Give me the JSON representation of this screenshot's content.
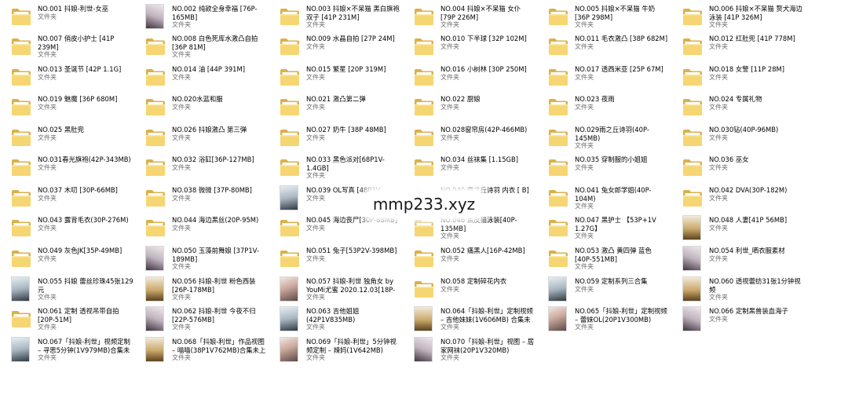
{
  "folder_type": "文件夹",
  "watermark": "mmp233.xyz",
  "items": [
    {
      "name": "NO.001 抖娘-利世-女巫",
      "thumb": "folder"
    },
    {
      "name": "NO.002 纯欲全身幸福 [76P-165MB]",
      "thumb": "img"
    },
    {
      "name": "NO.003 抖娘×不呆猫 黑白旗袍双子 [41P 231M]",
      "thumb": "folder"
    },
    {
      "name": "NO.004 抖娘×不呆猫 女仆 [79P 226M]",
      "thumb": "folder"
    },
    {
      "name": "NO.005 抖娘×不呆猫 牛奶 [36P 298M]",
      "thumb": "folder"
    },
    {
      "name": "NO.006 抖娘×不呆猫 赘犬海边泳装 [41P 326M]",
      "thumb": "folder"
    },
    {
      "name": "NO.007 俏皮小护士 [41P 239M]",
      "thumb": "folder"
    },
    {
      "name": "NO.008 白色死库水激凸自拍 [36P 81M]",
      "thumb": "folder"
    },
    {
      "name": "NO.009 水晶自拍 [27P 24M]",
      "thumb": "folder"
    },
    {
      "name": "NO.010 下半球 [32P 102M]",
      "thumb": "folder"
    },
    {
      "name": "NO.011 毛衣激凸 [38P 682M]",
      "thumb": "folder"
    },
    {
      "name": "NO.012 红肚兜 [41P 778M]",
      "thumb": "folder"
    },
    {
      "name": "NO.013 圣诞节 [42P 1.1G]",
      "thumb": "folder"
    },
    {
      "name": "NO.014 油 [44P 391M]",
      "thumb": "folder"
    },
    {
      "name": "NO.015 繁星 [20P 319M]",
      "thumb": "folder"
    },
    {
      "name": "NO.016 小树林 [30P 250M]",
      "thumb": "folder"
    },
    {
      "name": "NO.017 透西米亚 [25P 67M]",
      "thumb": "folder"
    },
    {
      "name": "NO.018 女警 [11P 28M]",
      "thumb": "folder"
    },
    {
      "name": "NO.019 魅魔 [36P 680M]",
      "thumb": "folder"
    },
    {
      "name": "NO.020水蓝和服",
      "thumb": "folder"
    },
    {
      "name": "NO.021 激凸第二弹",
      "thumb": "folder"
    },
    {
      "name": "NO.022 厨娘",
      "thumb": "folder"
    },
    {
      "name": "NO.023 夜雨",
      "thumb": "folder"
    },
    {
      "name": "NO.024 专属礼物",
      "thumb": "folder"
    },
    {
      "name": "NO.025 黑肚兜",
      "thumb": "folder"
    },
    {
      "name": "NO.026 抖娘激凸 第三弹",
      "thumb": "folder"
    },
    {
      "name": "NO.027 奶牛 [38P 48MB]",
      "thumb": "folder"
    },
    {
      "name": "NO.028窗帘房(42P-466MB)",
      "thumb": "folder"
    },
    {
      "name": "NO.029雨之丘诗羽(40P-145MB)",
      "thumb": "folder"
    },
    {
      "name": "NO.030钻(40P-96MB)",
      "thumb": "folder"
    },
    {
      "name": "NO.031春光旗袍(42P-343MB)",
      "thumb": "folder"
    },
    {
      "name": "NO.032 浴缸[36P-127MB]",
      "thumb": "folder"
    },
    {
      "name": "NO.033 黑色派对[68P1V-1.4GB]",
      "thumb": "folder"
    },
    {
      "name": "NO.034 丝袜集 [1.15GB]",
      "thumb": "folder"
    },
    {
      "name": "NO.035 穿制服的小姐姐",
      "thumb": "folder"
    },
    {
      "name": "NO.036 巫女",
      "thumb": "folder"
    },
    {
      "name": "NO.037 木叨 [30P-66MB]",
      "thumb": "folder"
    },
    {
      "name": "NO.038 微微 [37P-80MB]",
      "thumb": "folder"
    },
    {
      "name": "NO.039 OL写真 [48P1V",
      "thumb": "img"
    },
    {
      "name": "NO.040 霞之丘诗羽 内衣 [ B]",
      "thumb": "folder"
    },
    {
      "name": "NO.041 兔女郎学姐(40P-104M)",
      "thumb": "folder"
    },
    {
      "name": "NO.042 DVA(30P-182M)",
      "thumb": "folder"
    },
    {
      "name": "NO.043 露背毛衣(30P-276M)",
      "thumb": "folder"
    },
    {
      "name": "NO.044 海边黑丝(20P-95M)",
      "thumb": "folder"
    },
    {
      "name": "NO.045 海边丧尸[30P-88MB]",
      "thumb": "folder"
    },
    {
      "name": "NO.046 黑皮猫泳装[40P-135MB]",
      "thumb": "folder"
    },
    {
      "name": "NO.047 黑护士 【53P+1V 1.27G】",
      "thumb": "folder"
    },
    {
      "name": "NO.048 人妻[41P 56MB]",
      "thumb": "img"
    },
    {
      "name": "NO.049 灰色JK[35P-49MB]",
      "thumb": "folder"
    },
    {
      "name": "NO.050 玉藻前舞娘 [37P1V-189MB]",
      "thumb": "img"
    },
    {
      "name": "NO.051 兔子[53P2V-398MB]",
      "thumb": "folder"
    },
    {
      "name": "NO.052 痛黑人[16P-42MB]",
      "thumb": "folder"
    },
    {
      "name": "NO.053 激凸 黄四弹 蓝色 [40P-551MB]",
      "thumb": "folder"
    },
    {
      "name": "NO.054 利世_晒衣服素材",
      "thumb": "img"
    },
    {
      "name": "NO.055 抖娘 蕾丝珍珠45张129元",
      "thumb": "img"
    },
    {
      "name": "NO.056 抖娘-利世 粉色西装 [26P-178MB]",
      "thumb": "img"
    },
    {
      "name": "NO.057 抖娘-利世 独角女 by YouMi尤蜜 2020.12.03[18P-286...",
      "thumb": "img"
    },
    {
      "name": "NO.058 定制碎花内衣",
      "thumb": "folder"
    },
    {
      "name": "NO.059 定制系列三合集",
      "thumb": "img"
    },
    {
      "name": "NO.060 透视蕾纺31张1分钟视频",
      "thumb": "img"
    },
    {
      "name": "NO.061 定制 透视吊带自拍 [20P-51M]",
      "thumb": "folder"
    },
    {
      "name": "NO.062 抖娘-利世 今夜不归 [22P-576MB]",
      "thumb": "img"
    },
    {
      "name": "NO.063 吉他姐姐(42P1V835MB)",
      "thumb": "img"
    },
    {
      "name": "NO.064「抖娘-利世」定制视频 – 吉他妹妹(1V606MB) 合集未上传",
      "thumb": "img"
    },
    {
      "name": "NO.065「抖娘-利世」定制视频 – 蕾妹OL(20P1V300MB)",
      "thumb": "img"
    },
    {
      "name": "NO.066 定制黑兽装血海子",
      "thumb": "img"
    },
    {
      "name": "NO.067「抖娘-利世」视频定制 – 寻思5分钟(1V979MB)合集未上传",
      "thumb": "img"
    },
    {
      "name": "NO.068「抖娘-利世」作品视图 – 喵喵(38P1V762MB)合集未上传",
      "thumb": "img"
    },
    {
      "name": "NO.069「抖娘-利世」5分钟视频定制 – 辣妈(1V642MB)",
      "thumb": "img"
    },
    {
      "name": "NO.070「抖娘-利世」视图 – 居家网袜(20P1V320MB)",
      "thumb": "img"
    }
  ]
}
